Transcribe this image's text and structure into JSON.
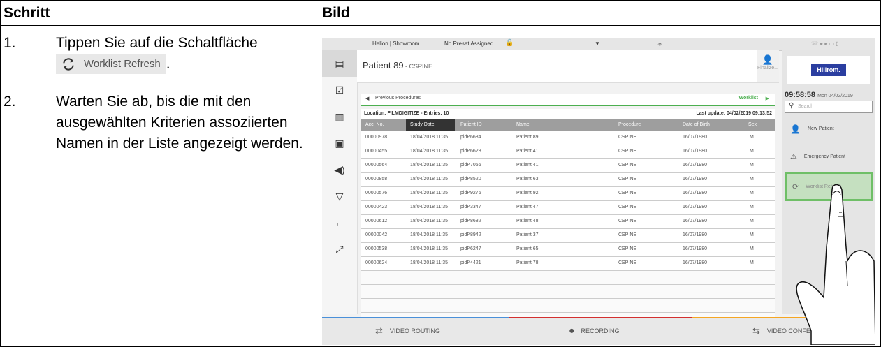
{
  "doc": {
    "col1_header": "Schritt",
    "col2_header": "Bild",
    "steps": [
      {
        "num": "1.",
        "text": "Tippen Sie auf die Schaltfläche",
        "suffix": "."
      },
      {
        "num": "2.",
        "text": "Warten Sie ab, bis die mit den ausgewählten Kriterien assoziierten Namen in der Liste angezeigt werden."
      }
    ],
    "inline_button_label": "Worklist Refresh"
  },
  "screen": {
    "topbar": {
      "room": "Helion | Showroom",
      "preset": "No Preset Assigned"
    },
    "patient": {
      "name": "Patient 89",
      "procedure": " - CSPINE",
      "finalize": "Finalize..."
    },
    "nav": {
      "prev": "Previous Procedures",
      "worklist": "Worklist"
    },
    "location": "Location: FILMDIGITIZE - Entries: 10",
    "last_update": "Last update: 04/02/2019 09:13:52",
    "columns": [
      "Acc. No.",
      "Study Date",
      "Patient ID",
      "Name",
      "Procedure",
      "Date of Birth",
      "Sex"
    ],
    "rows": [
      [
        "00000978",
        "18/04/2018 11:35",
        "pidP6684",
        "Patient 89",
        "CSPINE",
        "16/07/1980",
        "M"
      ],
      [
        "00000455",
        "18/04/2018 11:35",
        "pidP6628",
        "Patient 41",
        "CSPINE",
        "16/07/1980",
        "M"
      ],
      [
        "00000564",
        "18/04/2018 11:35",
        "pidP7056",
        "Patient 41",
        "CSPINE",
        "16/07/1980",
        "M"
      ],
      [
        "00000858",
        "18/04/2018 11:35",
        "pidP8520",
        "Patient 63",
        "CSPINE",
        "16/07/1980",
        "M"
      ],
      [
        "00000576",
        "18/04/2018 11:35",
        "pidP9276",
        "Patient 92",
        "CSPINE",
        "16/07/1980",
        "M"
      ],
      [
        "00000423",
        "18/04/2018 11:35",
        "pidP3347",
        "Patient 47",
        "CSPINE",
        "16/07/1980",
        "M"
      ],
      [
        "00000612",
        "18/04/2018 11:35",
        "pidP8682",
        "Patient 48",
        "CSPINE",
        "16/07/1980",
        "M"
      ],
      [
        "00000042",
        "18/04/2018 11:35",
        "pidP8942",
        "Patient 37",
        "CSPINE",
        "16/07/1980",
        "M"
      ],
      [
        "00000538",
        "18/04/2018 11:35",
        "pidP6247",
        "Patient 65",
        "CSPINE",
        "16/07/1980",
        "M"
      ],
      [
        "00000624",
        "18/04/2018 11:35",
        "pidP4421",
        "Patient 78",
        "CSPINE",
        "16/07/1980",
        "M"
      ]
    ],
    "right": {
      "logo": "Hillrom.",
      "time": "09:58:58",
      "date": "Mon 04/02/2019",
      "search_placeholder": "Search",
      "new_patient": "New Patient",
      "emergency": "Emergency Patient",
      "refresh": "Worklist Refresh"
    },
    "bottom": {
      "routing": "VIDEO ROUTING",
      "recording": "RECORDING",
      "conference": "VIDEO CONFEREN"
    },
    "colors": {
      "accent_green": "#6fbf67",
      "routing_line": "#4a90d9",
      "recording_line": "#d32f2f",
      "conference_line": "#f5a623"
    }
  }
}
